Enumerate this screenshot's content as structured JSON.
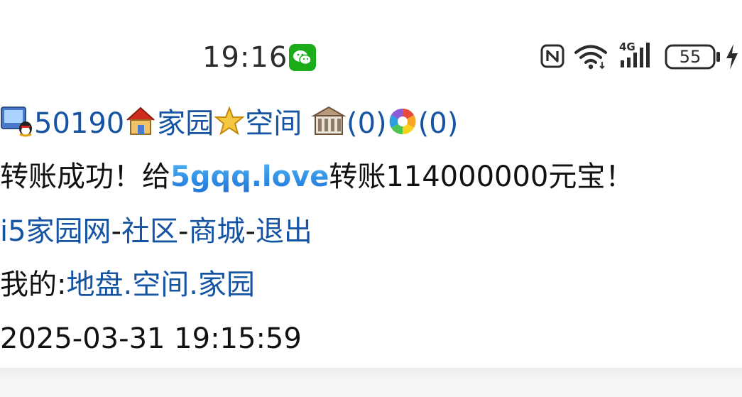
{
  "status_bar": {
    "time": "19:16",
    "signal_type": "4G",
    "battery": "55",
    "icons": [
      "wechat-icon",
      "nfc-icon",
      "wifi-icon",
      "signal-icon",
      "battery-icon",
      "charging-icon"
    ]
  },
  "header_line": {
    "user_id": "50190",
    "home_label": "家园",
    "space_label": "空间",
    "messages_count": "(0)",
    "notices_count": "(0)"
  },
  "message": {
    "prefix": "转账成功！给",
    "recipient": "5gqq.love",
    "suffix": "转账114000000元宝！"
  },
  "nav": {
    "site": "i5家园网",
    "sep1": "-",
    "community": "社区",
    "sep2": "-",
    "mall": "商城",
    "sep3": "-",
    "logout": "退出"
  },
  "mine": {
    "label": "我的:",
    "land": "地盘",
    "dot1": ".",
    "space": "空间",
    "dot2": ".",
    "home": "家园"
  },
  "timestamp": "2025-03-31 19:15:59",
  "colors": {
    "link": "#1553a3",
    "text": "#111111",
    "brand": "#2a8fe0",
    "wechat": "#1aad19"
  }
}
